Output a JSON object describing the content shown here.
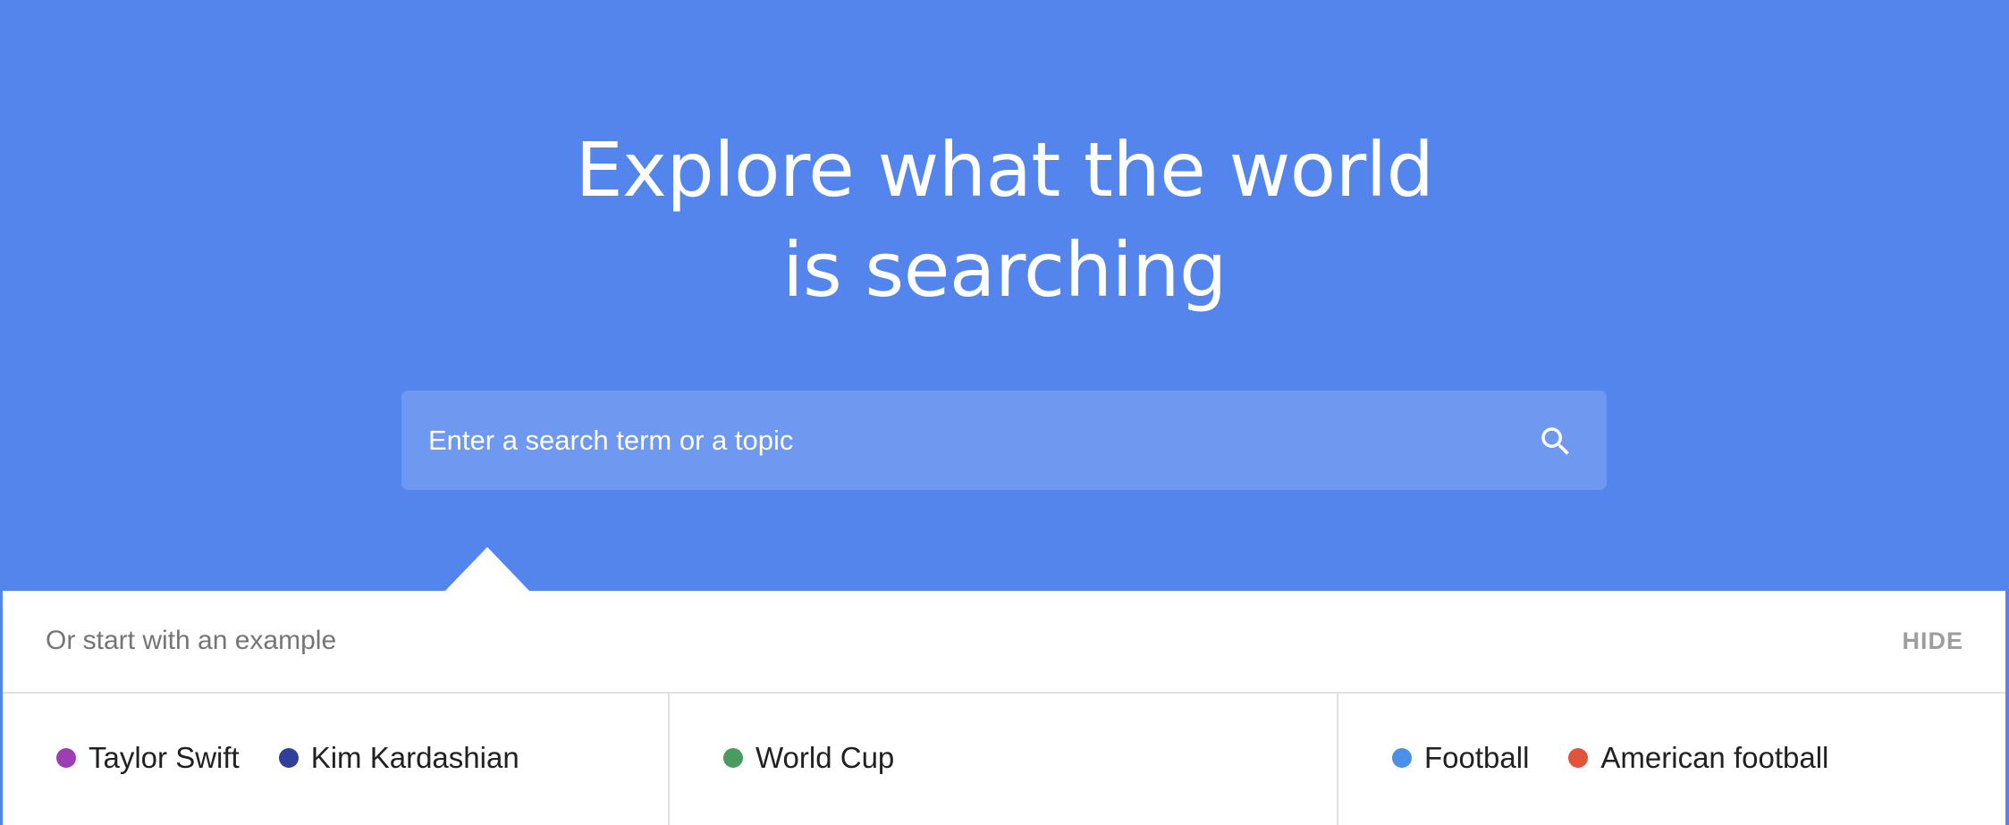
{
  "hero": {
    "headline_line1": "Explore what the world",
    "headline_line2": "is searching",
    "background_color": "#5485ec"
  },
  "search": {
    "placeholder": "Enter a search term or a topic",
    "value": "",
    "icon": "search-icon"
  },
  "examples": {
    "title": "Or start with an example",
    "hide_label": "HIDE",
    "columns": [
      {
        "items": [
          {
            "label": "Taylor Swift",
            "color": "#9c3fb5"
          },
          {
            "label": "Kim Kardashian",
            "color": "#2f3f9a"
          }
        ]
      },
      {
        "items": [
          {
            "label": "World Cup",
            "color": "#4a9b5e"
          }
        ]
      },
      {
        "items": [
          {
            "label": "Football",
            "color": "#4a90e8"
          },
          {
            "label": "American football",
            "color": "#e0533d"
          }
        ]
      }
    ]
  }
}
